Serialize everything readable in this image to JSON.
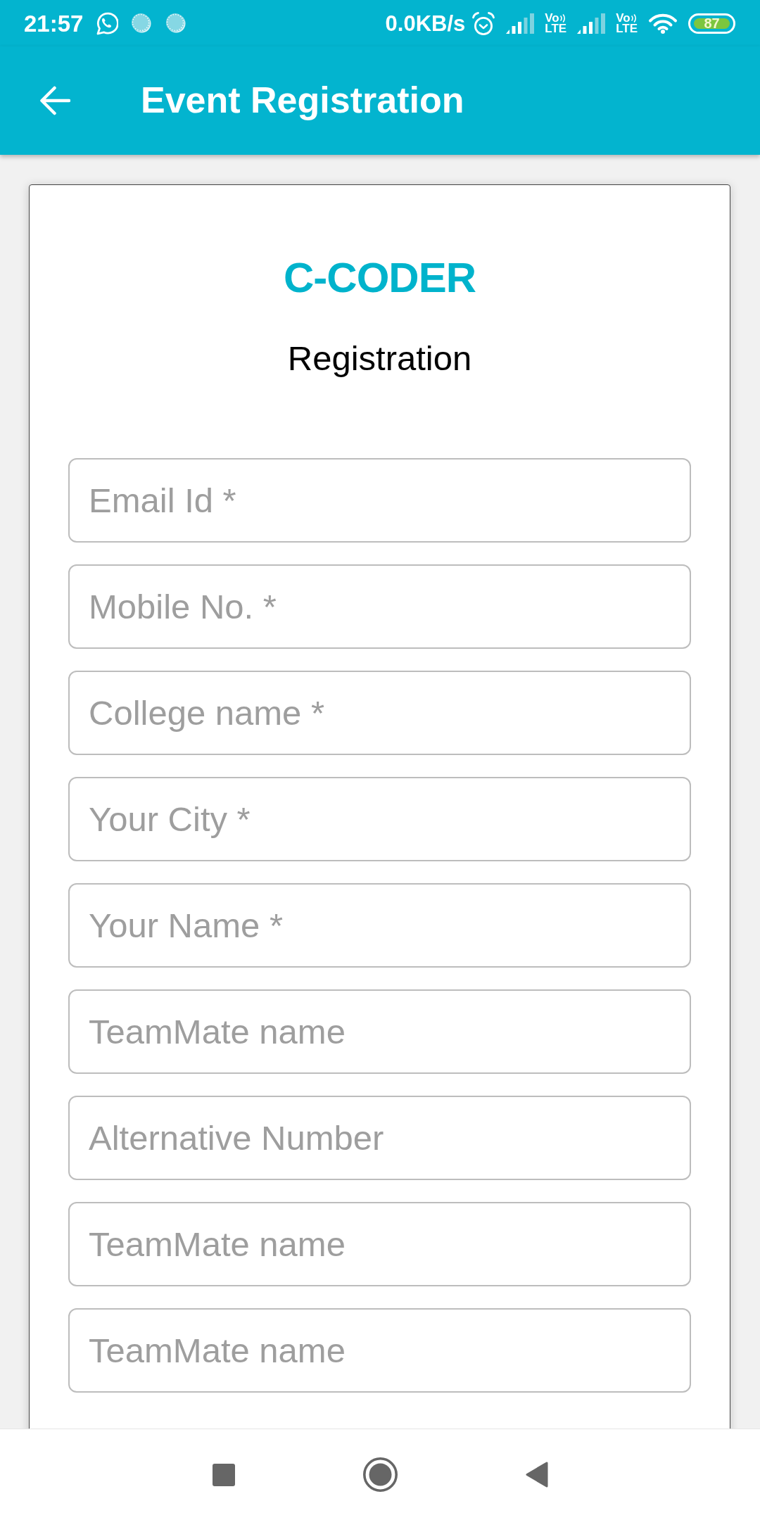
{
  "status_bar": {
    "time": "21:57",
    "network_speed": "0.0KB/s",
    "sim_indicators": [
      {
        "top_label": "Vo",
        "bottom_label": "LTE"
      },
      {
        "top_label": "Vo",
        "bottom_label": "LTE"
      }
    ],
    "battery": "87"
  },
  "app_bar": {
    "title": "Event Registration"
  },
  "form": {
    "logo": "C-CODER",
    "title": "Registration",
    "fields": [
      {
        "placeholder": "Email Id *"
      },
      {
        "placeholder": "Mobile No. *"
      },
      {
        "placeholder": "College name *"
      },
      {
        "placeholder": "Your City *"
      },
      {
        "placeholder": "Your Name *"
      },
      {
        "placeholder": "TeamMate name"
      },
      {
        "placeholder": "Alternative Number"
      },
      {
        "placeholder": "TeamMate name"
      },
      {
        "placeholder": "TeamMate name"
      }
    ]
  }
}
